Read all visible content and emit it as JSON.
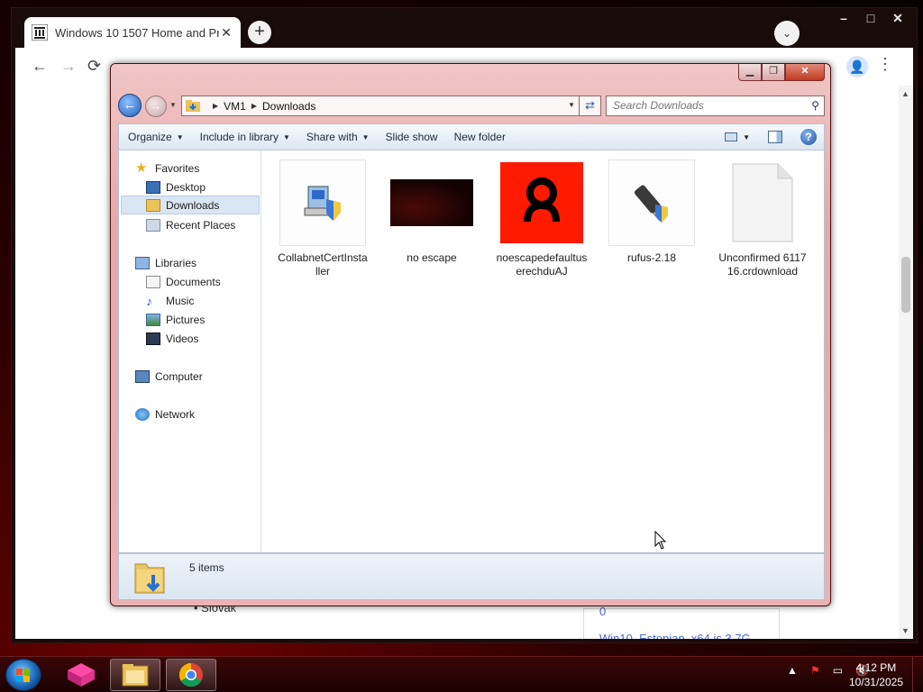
{
  "browser": {
    "tab_title": "Windows 10 1507 Home and Pr",
    "tab_close": "✕",
    "new_tab": "+",
    "window_buttons": [
      "–",
      "□",
      "✕"
    ],
    "nav": {
      "back": "←",
      "forward": "→",
      "reload": "⟳"
    },
    "page": {
      "slovak_text": "• Slovak",
      "link_zero": "0",
      "link_estonian": "Win10_Estonian_x64.is 3.7G"
    }
  },
  "explorer": {
    "breadcrumb": [
      "VM1",
      "Downloads"
    ],
    "search_placeholder": "Search Downloads",
    "commands": [
      {
        "label": "Organize",
        "dropdown": true
      },
      {
        "label": "Include in library",
        "dropdown": true
      },
      {
        "label": "Share with",
        "dropdown": true
      },
      {
        "label": "Slide show",
        "dropdown": false
      },
      {
        "label": "New folder",
        "dropdown": false
      }
    ],
    "nav_pane": {
      "favorites": {
        "label": "Favorites",
        "items": [
          "Desktop",
          "Downloads",
          "Recent Places"
        ],
        "selected": "Downloads"
      },
      "libraries": {
        "label": "Libraries",
        "items": [
          "Documents",
          "Music",
          "Pictures",
          "Videos"
        ]
      },
      "computer": "Computer",
      "network": "Network"
    },
    "files": [
      {
        "name": "CollabnetCertInstaller",
        "icon": "installer-shield-icon"
      },
      {
        "name": "no escape",
        "icon": "dark-image-thumbnail"
      },
      {
        "name": "noescapedefaultuserechduAJ",
        "icon": "red-logo-thumbnail"
      },
      {
        "name": "rufus-2.18",
        "icon": "usb-drive-shield-icon"
      },
      {
        "name": "Unconfirmed 611716.crdownload",
        "icon": "blank-file-icon"
      }
    ],
    "status": "5 items"
  },
  "taskbar": {
    "time": "4:12 PM",
    "date": "10/31/2025",
    "tray_arrow": "▲"
  }
}
